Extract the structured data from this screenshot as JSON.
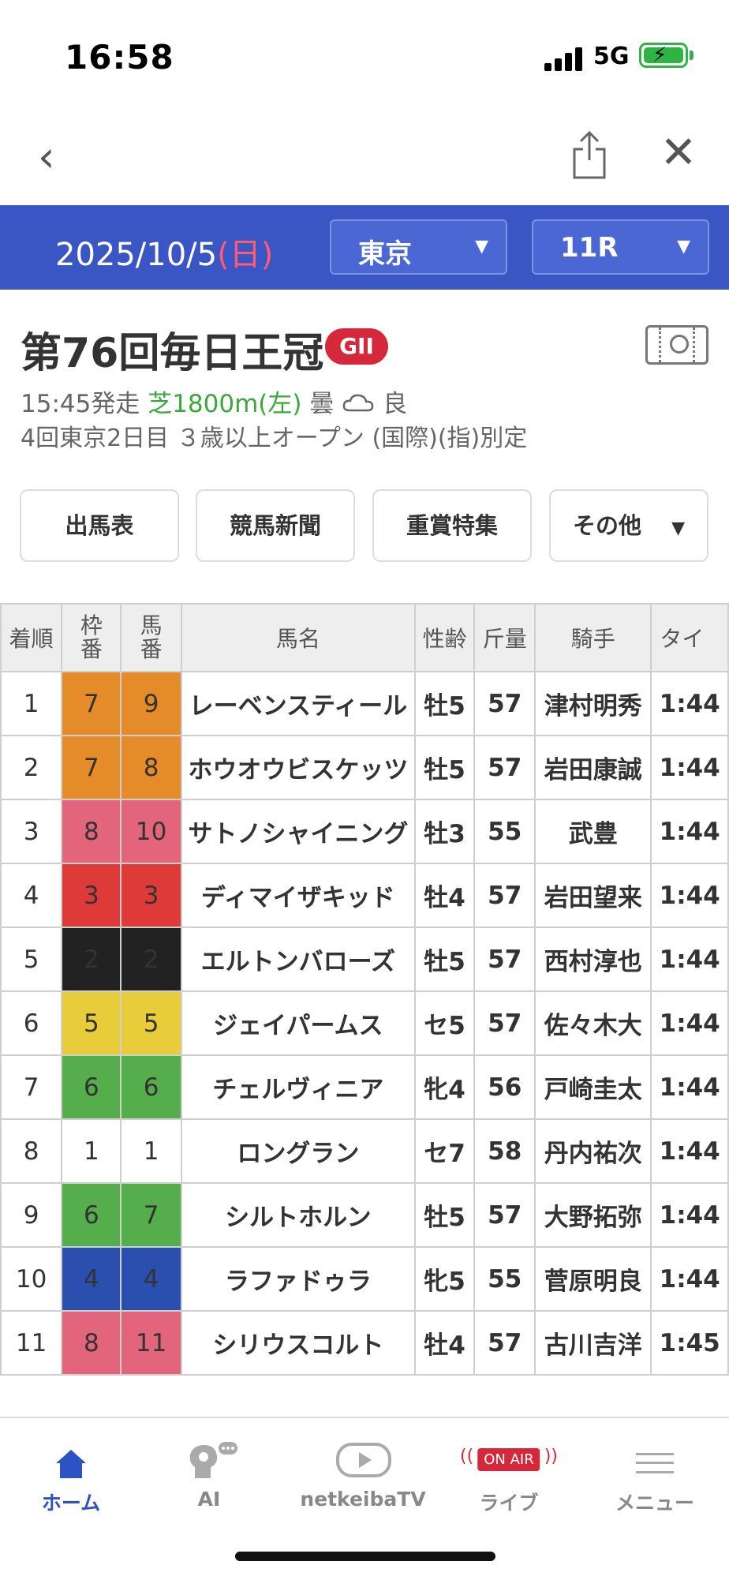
{
  "status_bar": {
    "time": "16:58",
    "network": "5G"
  },
  "date_bar": {
    "date": "2025/10/5",
    "weekday": "(日)",
    "venue": "東京",
    "race_no": "11R"
  },
  "race": {
    "title": "第76回毎日王冠",
    "grade": "GII",
    "start_time": "15:45発走",
    "course": "芝1800m(左)",
    "weather": "曇",
    "going": "良",
    "details": "4回東京2日目 ３歳以上オープン (国際)(指)別定"
  },
  "sub_nav": [
    "出馬表",
    "競馬新聞",
    "重賞特集",
    "その他"
  ],
  "table": {
    "headers": {
      "rank": "着順",
      "waku": [
        "枠",
        "番"
      ],
      "umaban": [
        "馬",
        "番"
      ],
      "name": "馬名",
      "sex_age": "性齢",
      "weight": "斤量",
      "jockey": "騎手",
      "time": "タイ"
    },
    "rows": [
      {
        "rank": "1",
        "waku": "7",
        "umaban": "9",
        "name": "レーベンスティール",
        "sex_age": "牡5",
        "weight": "57",
        "jockey": "津村明秀",
        "time": "1:44"
      },
      {
        "rank": "2",
        "waku": "7",
        "umaban": "8",
        "name": "ホウオウビスケッツ",
        "sex_age": "牡5",
        "weight": "57",
        "jockey": "岩田康誠",
        "time": "1:44"
      },
      {
        "rank": "3",
        "waku": "8",
        "umaban": "10",
        "name": "サトノシャイニング",
        "sex_age": "牡3",
        "weight": "55",
        "jockey": "武豊",
        "time": "1:44"
      },
      {
        "rank": "4",
        "waku": "3",
        "umaban": "3",
        "name": "ディマイザキッド",
        "sex_age": "牡4",
        "weight": "57",
        "jockey": "岩田望来",
        "time": "1:44"
      },
      {
        "rank": "5",
        "waku": "2",
        "umaban": "2",
        "name": "エルトンバローズ",
        "sex_age": "牡5",
        "weight": "57",
        "jockey": "西村淳也",
        "time": "1:44"
      },
      {
        "rank": "6",
        "waku": "5",
        "umaban": "5",
        "name": "ジェイパームス",
        "sex_age": "セ5",
        "weight": "57",
        "jockey": "佐々木大",
        "time": "1:44"
      },
      {
        "rank": "7",
        "waku": "6",
        "umaban": "6",
        "name": "チェルヴィニア",
        "sex_age": "牝4",
        "weight": "56",
        "jockey": "戸崎圭太",
        "time": "1:44"
      },
      {
        "rank": "8",
        "waku": "1",
        "umaban": "1",
        "name": "ロングラン",
        "sex_age": "セ7",
        "weight": "58",
        "jockey": "丹内祐次",
        "time": "1:44"
      },
      {
        "rank": "9",
        "waku": "6",
        "umaban": "7",
        "name": "シルトホルン",
        "sex_age": "牡5",
        "weight": "57",
        "jockey": "大野拓弥",
        "time": "1:44"
      },
      {
        "rank": "10",
        "waku": "4",
        "umaban": "4",
        "name": "ラファドゥラ",
        "sex_age": "牝5",
        "weight": "55",
        "jockey": "菅原明良",
        "time": "1:44"
      },
      {
        "rank": "11",
        "waku": "8",
        "umaban": "11",
        "name": "シリウスコルト",
        "sex_age": "牡4",
        "weight": "57",
        "jockey": "古川吉洋",
        "time": "1:45"
      }
    ]
  },
  "tab_bar": {
    "items": [
      {
        "label": "ホーム",
        "icon": "home-icon"
      },
      {
        "label": "AI",
        "icon": "ai-brain-icon"
      },
      {
        "label": "netkeibaTV",
        "icon": "play-icon"
      },
      {
        "label": "ライブ",
        "icon": "on-air-icon",
        "badge": "ON AIR"
      },
      {
        "label": "メニュー",
        "icon": "menu-icon"
      }
    ]
  },
  "colors": {
    "header_bg": "#3a56c4",
    "link_blue": "#1f3ea6",
    "grade_red": "#d6283b",
    "course_green": "#3aa83a"
  }
}
